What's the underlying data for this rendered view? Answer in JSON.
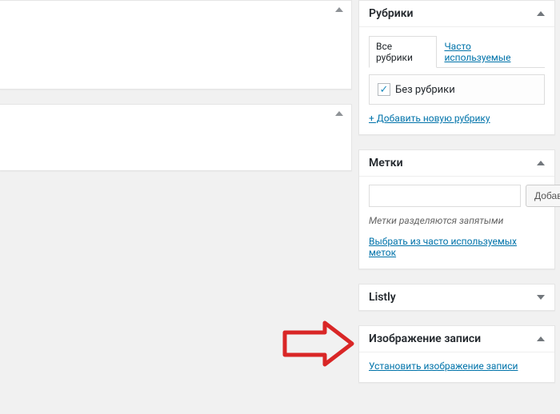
{
  "sidebar": {
    "categories": {
      "title": "Рубрики",
      "tabs": {
        "all": "Все рубрики",
        "popular": "Часто используемые"
      },
      "uncategorized": "Без рубрики",
      "add_link": "+ Добавить новую рубрику"
    },
    "tags": {
      "title": "Метки",
      "add_button": "Добавить",
      "separator_hint": "Метки разделяются запятыми",
      "popular_link": "Выбрать из часто используемых меток",
      "input_placeholder": ""
    },
    "listly": {
      "title": "Listly"
    },
    "featured": {
      "title": "Изображение записи",
      "set_link": "Установить изображение записи"
    }
  }
}
